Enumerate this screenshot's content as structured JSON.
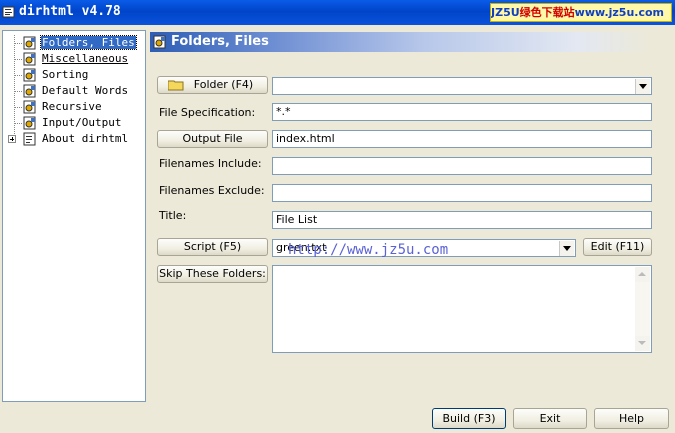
{
  "window": {
    "title": "dirhtml v4.78",
    "watermark_a": "JZ5U",
    "watermark_b": "绿色下载站",
    "watermark_c": "www.jz5u.com"
  },
  "tree": {
    "items": [
      {
        "label": "Folders, Files",
        "selected": true
      },
      {
        "label": "Miscellaneous",
        "link": true
      },
      {
        "label": "Sorting"
      },
      {
        "label": "Default Words"
      },
      {
        "label": "Recursive"
      },
      {
        "label": "Input/Output"
      },
      {
        "label": "About dirhtml",
        "expandable": true
      }
    ]
  },
  "panel": {
    "title": "Folders, Files"
  },
  "form": {
    "folder_button": "Folder (F4)",
    "folder_value": "",
    "file_spec_label": "File Specification:",
    "file_spec_value": "*.*",
    "output_button": "Output File",
    "output_value": "index.html",
    "include_label": "Filenames Include:",
    "include_value": "",
    "exclude_label": "Filenames Exclude:",
    "exclude_value": "",
    "title_label": "Title:",
    "title_value": "File List",
    "script_button": "Script (F5)",
    "script_value": "green.txt",
    "edit_button": "Edit (F11)",
    "skip_button": "Skip These Folders:",
    "skip_value": ""
  },
  "url_watermark": "http://www.jz5u.com",
  "footer": {
    "build": "Build (F3)",
    "exit": "Exit",
    "help": "Help"
  }
}
